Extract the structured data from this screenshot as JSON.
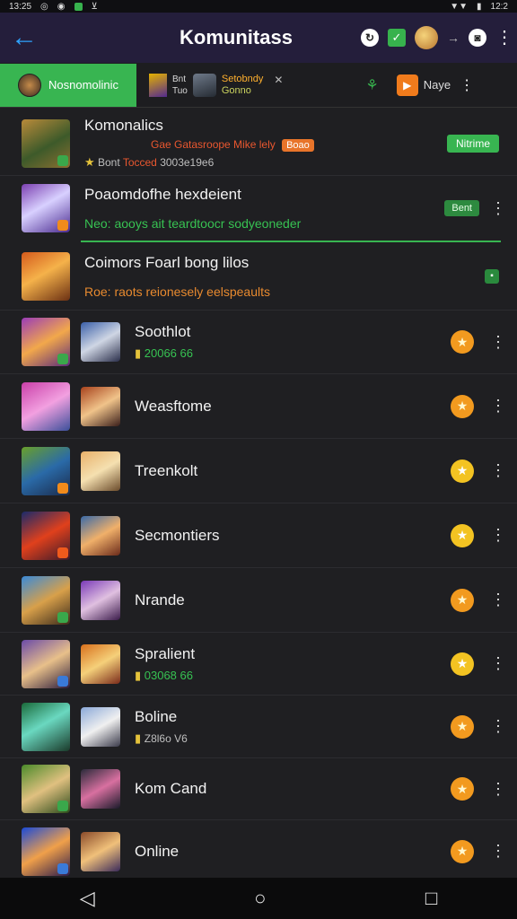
{
  "status_bar": {
    "time_left": "13:25",
    "time_right": "12:2"
  },
  "app_bar": {
    "title": "Komunitass"
  },
  "tabs": {
    "active_label": "Nosnomolinic",
    "mid_line1": "Bnt",
    "mid_line2": "Tuo",
    "mid_title": "Setobndy",
    "mid_sub": "Gonno",
    "right_label": "Naye"
  },
  "rows": [
    {
      "title": "Komonalics",
      "sub_red": "Gae Gatasroope Mike lely",
      "pill": "Boao",
      "meta": "Bont",
      "meta_orange": "Tocced",
      "meta_gray": "3003e19e6",
      "badge": "Nitrime"
    },
    {
      "title": "Poaomdofhe hexdeient",
      "sub": "Neo: aooys ait teardtoocr sodyeoneder",
      "badge": "Bent"
    },
    {
      "title": "Coimors Foarl bong lilos",
      "sub": "Roe: raots reionesely eelspeaults"
    },
    {
      "title": "Soothlot",
      "meta": "20066 66"
    },
    {
      "title": "Weasftome"
    },
    {
      "title": "Treenkolt"
    },
    {
      "title": "Secmontiers"
    },
    {
      "title": "Nrande"
    },
    {
      "title": "Spralient",
      "meta": "03068 66"
    },
    {
      "title": "Boline",
      "meta": "Z8l6o V6"
    },
    {
      "title": "Kom Cand"
    },
    {
      "title": "Online"
    }
  ],
  "colors": {
    "accent_green": "#38b551",
    "app_bar": "#241e3b",
    "star_orange": "#f29a1f",
    "star_yellow": "#f3c322"
  },
  "icons": {
    "back": "arrow-left-icon",
    "menu": "more-vert-icon",
    "star": "star-icon"
  }
}
